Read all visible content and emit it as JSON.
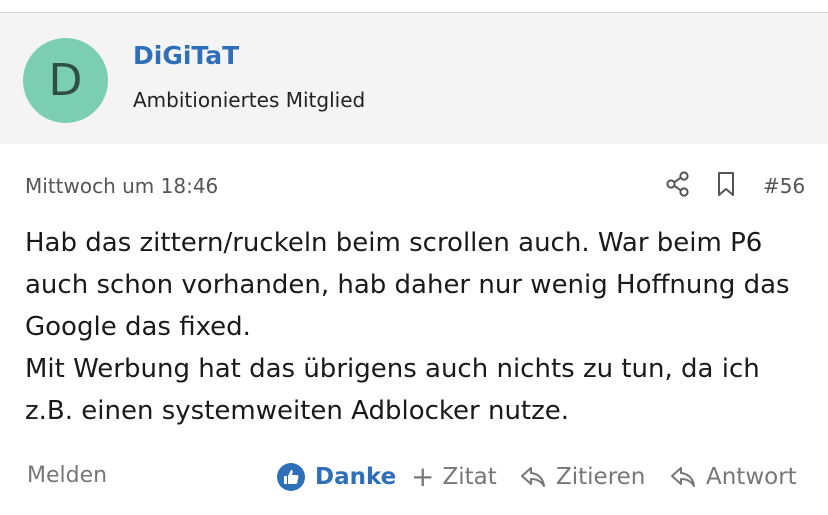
{
  "author": {
    "avatar_letter": "D",
    "username": "DiGiTaT",
    "title": "Ambitioniertes Mitglied"
  },
  "post": {
    "date": "Mittwoch um 18:46",
    "number": "#56",
    "body": [
      "Hab das zittern/ruckeln beim scrollen auch. War beim P6 auch schon vorhanden, hab daher nur wenig Hoffnung das Google das fixed.",
      "Mit Werbung hat das übrigens auch nichts zu tun, da ich z.B. einen systemweiten Adblocker nutze."
    ]
  },
  "actions": {
    "report": "Melden",
    "like": "Danke",
    "multiquote": "Zitat",
    "quote": "Zitieren",
    "reply": "Antwort"
  },
  "colors": {
    "accent": "#2e6fb7",
    "avatar_bg": "#7bceb2",
    "header_bg": "#f4f4f4"
  }
}
